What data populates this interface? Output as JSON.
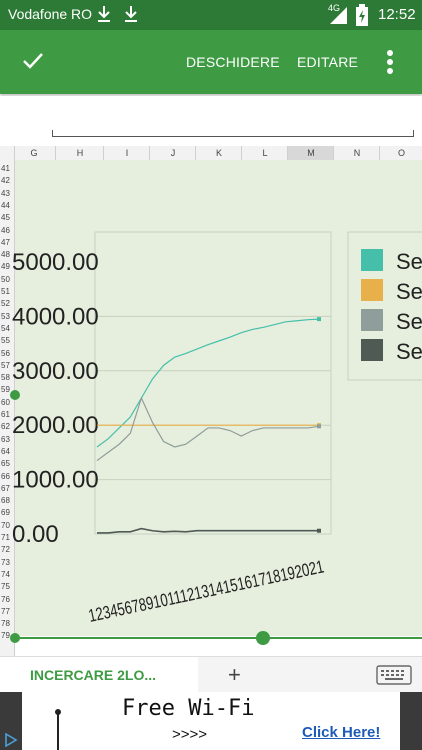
{
  "status_bar": {
    "carrier": "Vodafone RO",
    "network": "4G",
    "time": "12:52"
  },
  "app_bar": {
    "open_label": "DESCHIDERE",
    "edit_label": "EDITARE"
  },
  "sheet": {
    "columns": [
      "G",
      "H",
      "I",
      "J",
      "K",
      "L",
      "M",
      "N",
      "O"
    ],
    "rows": [
      "41",
      "42",
      "43",
      "44",
      "45",
      "46",
      "47",
      "48",
      "49",
      "50",
      "51",
      "52",
      "53",
      "54",
      "55",
      "56",
      "57",
      "58",
      "59",
      "60",
      "61",
      "62",
      "63",
      "64",
      "65",
      "66",
      "67",
      "68",
      "69",
      "70",
      "71",
      "72",
      "73",
      "74",
      "75",
      "76",
      "77",
      "78",
      "79"
    ],
    "tab_name": "INCERCARE 2LO...",
    "add_tab": "+"
  },
  "chart": {
    "y_ticks": [
      "5000.00",
      "4000.00",
      "3000.00",
      "2000.00",
      "1000.00",
      "0.00"
    ],
    "legend": [
      "Se",
      "Se",
      "Se",
      "Se"
    ],
    "colors": {
      "series1": "#45bfaa",
      "series2": "#e8b04a",
      "series3": "#8f9e9a",
      "series4": "#4f5a54"
    },
    "x_labels": "123456789101112131415161718192021"
  },
  "chart_data": {
    "type": "line",
    "title": "",
    "xlabel": "",
    "ylabel": "",
    "ylim": [
      0,
      5000
    ],
    "x": [
      1,
      2,
      3,
      4,
      5,
      6,
      7,
      8,
      9,
      10,
      11,
      12,
      13,
      14,
      15,
      16,
      17,
      18,
      19,
      20,
      21
    ],
    "legend_position": "right",
    "series": [
      {
        "values": [
          1600,
          1750,
          1950,
          2150,
          2500,
          2850,
          3100,
          3250,
          3320,
          3400,
          3480,
          3550,
          3620,
          3700,
          3760,
          3800,
          3850,
          3900,
          3920,
          3940,
          3950
        ]
      },
      {
        "values": [
          2000,
          2000,
          2000,
          2000,
          2000,
          2000,
          2000,
          2000,
          2000,
          2000,
          2000,
          2000,
          2000,
          2000,
          2000,
          2000,
          2000,
          2000,
          2000,
          2000,
          2000
        ]
      },
      {
        "values": [
          1350,
          1500,
          1650,
          1850,
          2500,
          2050,
          1700,
          1600,
          1650,
          1800,
          1950,
          1950,
          1900,
          1800,
          1900,
          1950,
          1950,
          1950,
          1950,
          1950,
          1980
        ]
      },
      {
        "values": [
          20,
          20,
          40,
          40,
          100,
          60,
          40,
          50,
          40,
          60,
          60,
          60,
          60,
          60,
          60,
          60,
          60,
          60,
          60,
          60,
          60
        ]
      }
    ]
  },
  "ad": {
    "headline": "Free Wi-Fi",
    "arrows": ">>>>",
    "cta": "Click Here!"
  }
}
